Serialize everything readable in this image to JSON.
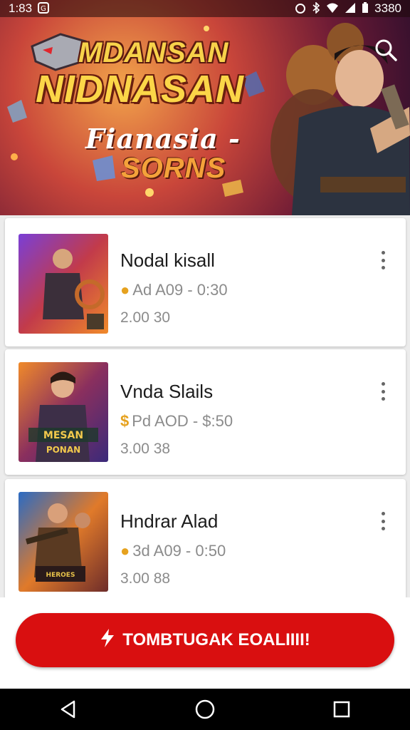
{
  "status_bar": {
    "time": "1:83",
    "right_text": "3380",
    "icons": [
      "notification-icon",
      "alarm-icon",
      "bluetooth-icon",
      "wifi-icon",
      "signal-icon",
      "battery-icon"
    ]
  },
  "banner": {
    "title_line1": "MDANSAN",
    "title_line2": "NIDNASAN",
    "subtitle_line1": "Fianasia -",
    "subtitle_line2": "SORNS",
    "search_icon": "search-icon"
  },
  "items": [
    {
      "title": "Nodal kisall",
      "price": "Ad A09  - 0:30",
      "count": "2.00 30",
      "coin_icon": "coin-icon"
    },
    {
      "title": "Vnda Slails",
      "price": "Pd AOD  - $:50",
      "count": "3.00 38",
      "coin_icon": "dollar-icon"
    },
    {
      "title": "Hndrar Alad",
      "price": "3d A09  - 0:50",
      "count": "3.00 88",
      "coin_icon": "coin-icon"
    }
  ],
  "cta": {
    "label": "TOMBTUGAK EOALIIII!",
    "icon": "lightning-icon"
  },
  "nav": {
    "back": "back-icon",
    "home": "home-icon",
    "recents": "recents-icon"
  },
  "colors": {
    "accent": "#d90f10",
    "coin": "#e6a21f"
  }
}
